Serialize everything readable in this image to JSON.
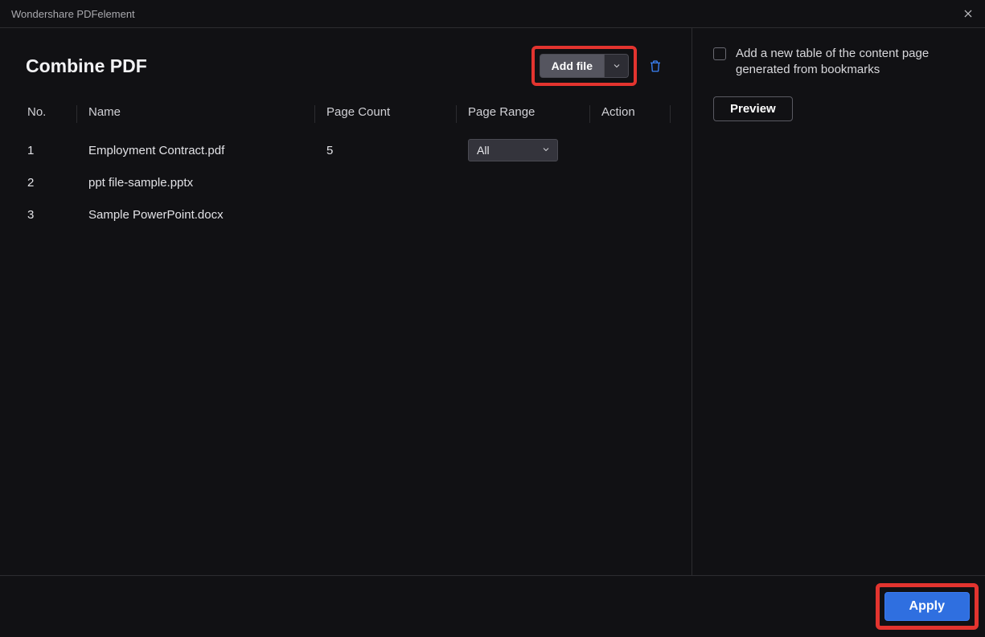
{
  "window": {
    "title": "Wondershare PDFelement"
  },
  "page": {
    "title": "Combine PDF"
  },
  "toolbar": {
    "add_file_label": "Add file"
  },
  "columns": {
    "no": "No.",
    "name": "Name",
    "page_count": "Page Count",
    "page_range": "Page Range",
    "action": "Action"
  },
  "page_range_select": {
    "value": "All"
  },
  "rows": [
    {
      "no": "1",
      "name": "Employment Contract.pdf",
      "page_count": "5"
    },
    {
      "no": "2",
      "name": "ppt file-sample.pptx",
      "page_count": ""
    },
    {
      "no": "3",
      "name": "Sample PowerPoint.docx",
      "page_count": ""
    }
  ],
  "sidebar": {
    "toc_option": "Add a new table of the content page generated from bookmarks",
    "preview_label": "Preview"
  },
  "footer": {
    "apply_label": "Apply"
  }
}
